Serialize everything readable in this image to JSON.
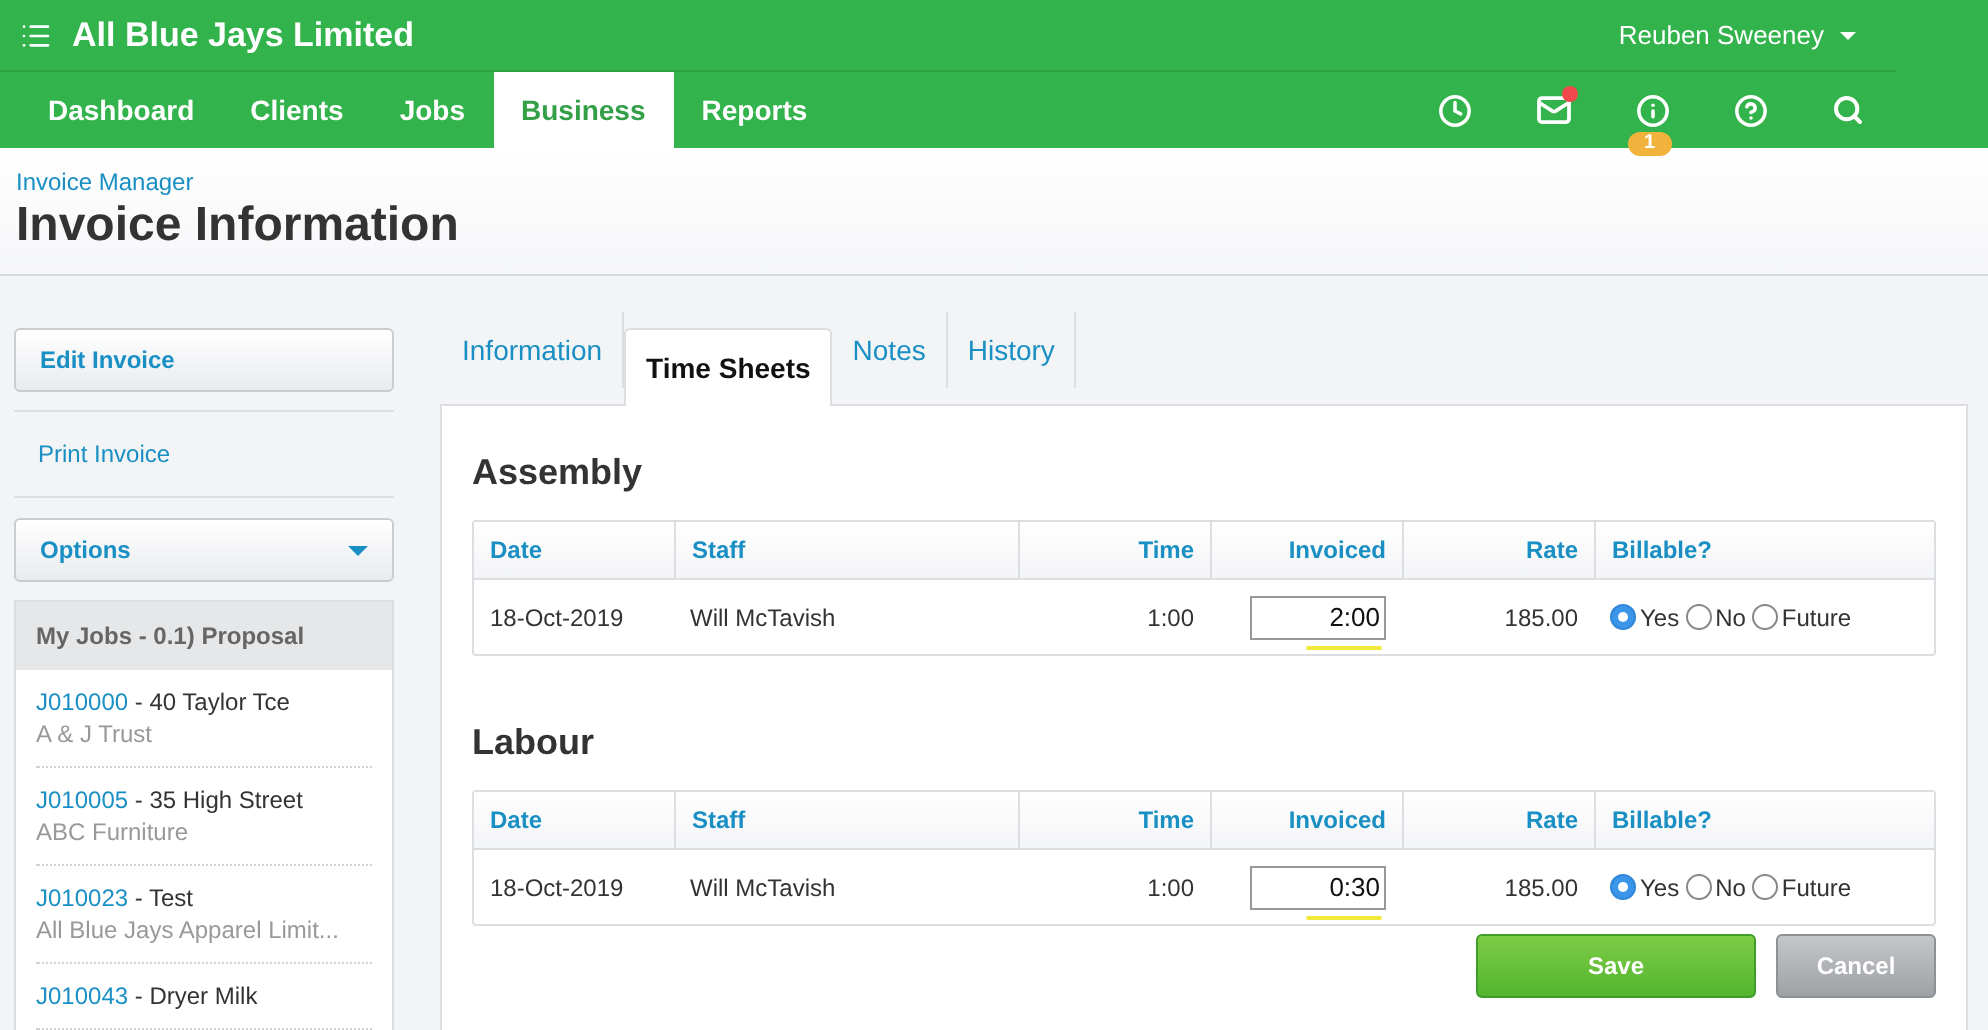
{
  "header": {
    "company": "All Blue Jays Limited",
    "user": "Reuben Sweeney"
  },
  "nav": [
    {
      "label": "Dashboard",
      "selected": false
    },
    {
      "label": "Clients",
      "selected": false
    },
    {
      "label": "Jobs",
      "selected": false
    },
    {
      "label": "Business",
      "selected": true
    },
    {
      "label": "Reports",
      "selected": false
    }
  ],
  "toolbar": {
    "mail_unread": true,
    "info_badge": "1"
  },
  "breadcrumb": "Invoice Manager",
  "page_title": "Invoice Information",
  "sidebar": {
    "edit_button": "Edit Invoice",
    "print_link": "Print Invoice",
    "options_button": "Options",
    "jobs_heading": "My Jobs - 0.1) Proposal",
    "jobs": [
      {
        "code": "J010000",
        "title": " - 40 Taylor Tce",
        "client": "A & J Trust"
      },
      {
        "code": "J010005",
        "title": " - 35 High Street",
        "client": "ABC Furniture"
      },
      {
        "code": "J010023",
        "title": " - Test",
        "client": "All Blue Jays Apparel Limit..."
      },
      {
        "code": "J010043",
        "title": " - Dryer Milk"
      }
    ]
  },
  "tabs": [
    {
      "label": "Information",
      "selected": false
    },
    {
      "label": "Time Sheets",
      "selected": true
    },
    {
      "label": "Notes",
      "selected": false
    },
    {
      "label": "History",
      "selected": false
    }
  ],
  "sections": [
    {
      "title": "Assembly",
      "columns": [
        "Date",
        "Staff",
        "Time",
        "Invoiced",
        "Rate",
        "Billable?"
      ],
      "rows": [
        {
          "date": "18-Oct-2019",
          "staff": "Will McTavish",
          "time": "1:00",
          "invoiced": "2:00",
          "rate": "185.00",
          "billable": [
            {
              "label": "Yes",
              "selected": true
            },
            {
              "label": "No",
              "selected": false
            },
            {
              "label": "Future",
              "selected": false
            }
          ]
        }
      ]
    },
    {
      "title": "Labour",
      "columns": [
        "Date",
        "Staff",
        "Time",
        "Invoiced",
        "Rate",
        "Billable?"
      ],
      "rows": [
        {
          "date": "18-Oct-2019",
          "staff": "Will McTavish",
          "time": "1:00",
          "invoiced": "0:30",
          "rate": "185.00",
          "billable": [
            {
              "label": "Yes",
              "selected": true
            },
            {
              "label": "No",
              "selected": false
            },
            {
              "label": "Future",
              "selected": false
            }
          ]
        }
      ]
    }
  ],
  "buttons": {
    "save": "Save",
    "cancel": "Cancel"
  }
}
